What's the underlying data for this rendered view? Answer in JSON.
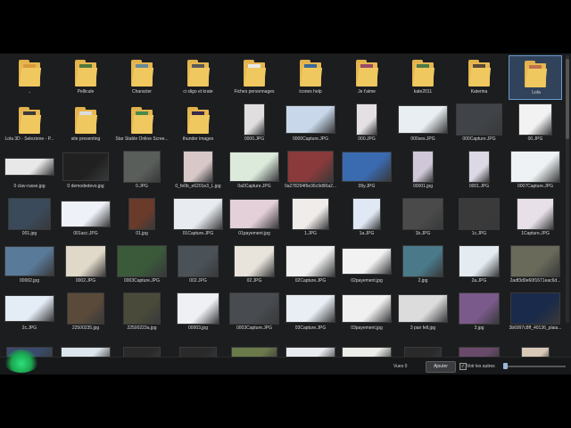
{
  "explorer": {
    "rows": [
      [
        {
          "label": "..",
          "kind": "folder",
          "inset": "#d89a3a"
        },
        {
          "label": "Pellicule",
          "kind": "folder",
          "inset": "#4e7a3a"
        },
        {
          "label": "Character",
          "kind": "folder",
          "inset": "#6a8a9a"
        },
        {
          "label": "ci sligo et krate",
          "kind": "folder",
          "inset": "#5a5a5a"
        },
        {
          "label": "Fiches personnages",
          "kind": "folder",
          "inset": "#e8e8e8"
        },
        {
          "label": "icones help",
          "kind": "folder",
          "inset": "#3a6a9a"
        },
        {
          "label": "Je t'aime",
          "kind": "folder",
          "inset": "#9a4a6a"
        },
        {
          "label": "kate2011",
          "kind": "folder",
          "inset": "#4a7a4a"
        },
        {
          "label": "Katerina",
          "kind": "folder",
          "inset": "#5a4a3a"
        },
        {
          "label": "Lola",
          "kind": "folder",
          "inset": "#c07050",
          "selected": true
        }
      ],
      [
        {
          "label": "Lola 3D - Selezione - P...",
          "kind": "folder",
          "inset": "#3a3a3a"
        },
        {
          "label": "site presenting",
          "kind": "folder",
          "inset": "#dcdcdc"
        },
        {
          "label": "Star Stable Online Scree...",
          "kind": "folder",
          "inset": "#4a8a4a"
        },
        {
          "label": "thunder images",
          "kind": "folder",
          "inset": "#3a2a4a"
        },
        {
          "label": "0000.JPG",
          "kind": "image",
          "color": "#e0dede",
          "w": 22,
          "h": 34
        },
        {
          "label": "0000Capture.JPG",
          "kind": "image",
          "color": "#c8d8ea",
          "w": 54,
          "h": 30
        },
        {
          "label": "000.JPG",
          "kind": "image",
          "color": "#e4e0e4",
          "w": 22,
          "h": 34
        },
        {
          "label": "000ses.JPG",
          "kind": "image",
          "color": "#e8eef2",
          "w": 54,
          "h": 30
        },
        {
          "label": "000Capture.JPG",
          "kind": "image",
          "color": "#404448",
          "w": 50,
          "h": 34
        },
        {
          "label": "00.JPG",
          "kind": "image",
          "color": "#f2f2f2",
          "w": 36,
          "h": 34
        }
      ],
      [
        {
          "label": "0 clav-russe.jpg",
          "kind": "image",
          "color": "#e8e8e8",
          "w": 54,
          "h": 18
        },
        {
          "label": "0 demodedevo.jpg",
          "kind": "image",
          "color": "#202020",
          "w": 50,
          "h": 30
        },
        {
          "label": "0.JPG",
          "kind": "image",
          "color": "#5a5e5a",
          "w": 40,
          "h": 34
        },
        {
          "label": "0_fe0b_e6201e3_L.jpg",
          "kind": "image",
          "color": "#d8c8c8",
          "w": 32,
          "h": 34
        },
        {
          "label": "0a0Capture.JPG",
          "kind": "image",
          "color": "#dceadc",
          "w": 54,
          "h": 32
        },
        {
          "label": "0a278294f6e36c9d90a2...",
          "kind": "image",
          "color": "#8a3a3a",
          "w": 50,
          "h": 34
        },
        {
          "label": "09y.JPG",
          "kind": "image",
          "color": "#3a6ab0",
          "w": 54,
          "h": 32
        },
        {
          "label": "00001.jpg",
          "kind": "image",
          "color": "#d0c8d8",
          "w": 22,
          "h": 34
        },
        {
          "label": "0001.JPG",
          "kind": "image",
          "color": "#dcd8e4",
          "w": 22,
          "h": 34
        },
        {
          "label": "0007Capture.JPG",
          "kind": "image",
          "color": "#eef2f4",
          "w": 54,
          "h": 34
        }
      ],
      [
        {
          "label": "001.jpg",
          "kind": "image",
          "color": "#3a4a5a",
          "w": 46,
          "h": 34
        },
        {
          "label": "001acc.JPG",
          "kind": "image",
          "color": "#eef2f8",
          "w": 54,
          "h": 28
        },
        {
          "label": "01.jpg",
          "kind": "image",
          "color": "#6a3a2a",
          "w": 28,
          "h": 34
        },
        {
          "label": "01Capture.JPG",
          "kind": "image",
          "color": "#e8ecf0",
          "w": 54,
          "h": 34
        },
        {
          "label": "01payement.jpg",
          "kind": "image",
          "color": "#e4d0d8",
          "w": 54,
          "h": 32
        },
        {
          "label": "1.JPG",
          "kind": "image",
          "color": "#f0ecea",
          "w": 40,
          "h": 34
        },
        {
          "label": "1a.JPG",
          "kind": "image",
          "color": "#e0e8f4",
          "w": 30,
          "h": 34
        },
        {
          "label": "1b.JPG",
          "kind": "image",
          "color": "#4a4a4a",
          "w": 44,
          "h": 34
        },
        {
          "label": "1c.JPG",
          "kind": "image",
          "color": "#3a3a3a",
          "w": 44,
          "h": 34
        },
        {
          "label": "1Capture.JPG",
          "kind": "image",
          "color": "#e8e0e8",
          "w": 40,
          "h": 34
        }
      ],
      [
        {
          "label": "00002.jpg",
          "kind": "image",
          "color": "#5a7a9a",
          "w": 54,
          "h": 32
        },
        {
          "label": "0002.JPG",
          "kind": "image",
          "color": "#e0d8c8",
          "w": 44,
          "h": 34
        },
        {
          "label": "0003Capture.JPG",
          "kind": "image",
          "color": "#3a5a3a",
          "w": 54,
          "h": 34
        },
        {
          "label": "002.JPG",
          "kind": "image",
          "color": "#4a5258",
          "w": 44,
          "h": 34
        },
        {
          "label": "02.JPG",
          "kind": "image",
          "color": "#e8e4dc",
          "w": 44,
          "h": 34
        },
        {
          "label": "02Capture.JPG",
          "kind": "image",
          "color": "#f0f0f0",
          "w": 54,
          "h": 34
        },
        {
          "label": "02payement.jpg",
          "kind": "image",
          "color": "#f2f2f2",
          "w": 54,
          "h": 28
        },
        {
          "label": "2.jpg",
          "kind": "image",
          "color": "#4a7a8a",
          "w": 44,
          "h": 34
        },
        {
          "label": "2a.JPG",
          "kind": "image",
          "color": "#e4ecf2",
          "w": 44,
          "h": 34
        },
        {
          "label": "2adf3d9e60f1671eac6d...",
          "kind": "image",
          "color": "#6a6a5a",
          "w": 54,
          "h": 34
        }
      ],
      [
        {
          "label": "2c.JPG",
          "kind": "image",
          "color": "#e4ecf6",
          "w": 54,
          "h": 28
        },
        {
          "label": "22500235.jpg",
          "kind": "image",
          "color": "#5a4a3a",
          "w": 40,
          "h": 34
        },
        {
          "label": "22500223a.jpg",
          "kind": "image",
          "color": "#4a4a3a",
          "w": 40,
          "h": 34
        },
        {
          "label": "00003.jpg",
          "kind": "image",
          "color": "#eef0f4",
          "w": 46,
          "h": 34
        },
        {
          "label": "0003Capture.JPG",
          "kind": "image",
          "color": "#484c50",
          "w": 54,
          "h": 34
        },
        {
          "label": "03Capture.JPG",
          "kind": "image",
          "color": "#e8eef4",
          "w": 54,
          "h": 30
        },
        {
          "label": "03payement.jpg",
          "kind": "image",
          "color": "#f0f0f0",
          "w": 54,
          "h": 30
        },
        {
          "label": "3 pan fell.jpg",
          "kind": "image",
          "color": "#dcdcdc",
          "w": 54,
          "h": 30
        },
        {
          "label": "3.jpg",
          "kind": "image",
          "color": "#7a5a8a",
          "w": 44,
          "h": 34
        },
        {
          "label": "3b6997c8ff_40136_plaia...",
          "kind": "image",
          "color": "#1a2a4a",
          "w": 54,
          "h": 34
        }
      ],
      [
        {
          "label": "",
          "kind": "image",
          "color": "#3a4a6a",
          "w": 50,
          "h": 18
        },
        {
          "label": "",
          "kind": "image",
          "color": "#dce4ec",
          "w": 54,
          "h": 18
        },
        {
          "label": "",
          "kind": "image",
          "color": "#2a2a2a",
          "w": 40,
          "h": 18
        },
        {
          "label": "",
          "kind": "image",
          "color": "#2a2a2a",
          "w": 40,
          "h": 18
        },
        {
          "label": "",
          "kind": "image",
          "color": "#6a7a4a",
          "w": 50,
          "h": 18
        },
        {
          "label": "",
          "kind": "image",
          "color": "#e8ecf0",
          "w": 54,
          "h": 18
        },
        {
          "label": "",
          "kind": "image",
          "color": "#ecece8",
          "w": 54,
          "h": 18
        },
        {
          "label": "",
          "kind": "image",
          "color": "#2a2a2a",
          "w": 40,
          "h": 18
        },
        {
          "label": "",
          "kind": "image",
          "color": "#6a4a6a",
          "w": 44,
          "h": 18
        },
        {
          "label": "",
          "kind": "image",
          "color": "#d8c8b8",
          "w": 30,
          "h": 18
        }
      ]
    ]
  },
  "statusbar": {
    "view_text": "Vues 0",
    "add_button": "Ajouter",
    "show_all_label": "Voir les autres",
    "show_all_checked": true,
    "zoom_level": 0
  },
  "colors": {
    "folder": "#e6b650",
    "selection": "#6a9ad0",
    "background": "#1c1d1f"
  }
}
